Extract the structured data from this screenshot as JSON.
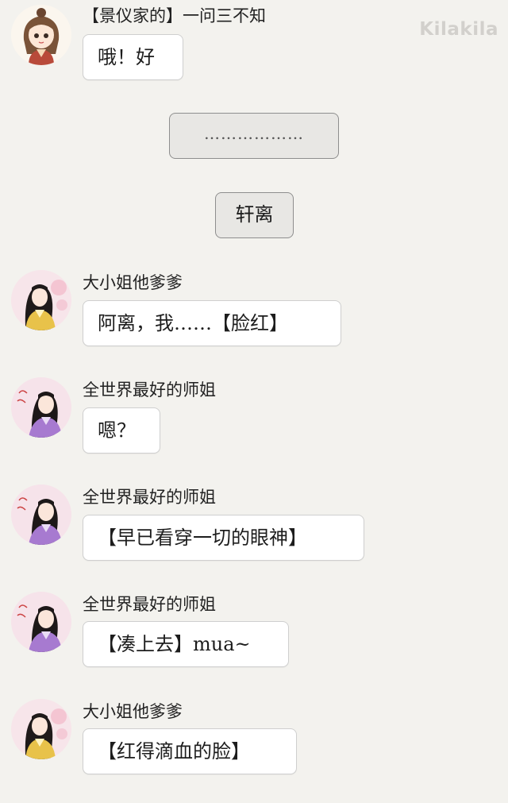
{
  "watermark": "Kilakila",
  "messages": [
    {
      "sender": "【景仪家的】一问三不知",
      "text": "哦！好"
    },
    {
      "sender": "大小姐他爹爹",
      "text": "阿离，我……【脸红】"
    },
    {
      "sender": "全世界最好的师姐",
      "text": "嗯？"
    },
    {
      "sender": "全世界最好的师姐",
      "text": "【早已看穿一切的眼神】"
    },
    {
      "sender": "全世界最好的师姐",
      "text": "【凑上去】mua~"
    },
    {
      "sender": "大小姐他爹爹",
      "text": "【红得滴血的脸】"
    }
  ],
  "narration": [
    {
      "text": "………………"
    },
    {
      "text": "轩离"
    }
  ],
  "avatar_icons": [
    "chibi-girl-avatar-icon",
    "yellow-robe-lady-avatar-icon",
    "purple-robe-lady-avatar-icon"
  ],
  "colors": {
    "background": "#f3f2ee",
    "bubble": "#ffffff",
    "narration_bubble": "#e8e7e4",
    "watermark": "#d2d0cc"
  }
}
